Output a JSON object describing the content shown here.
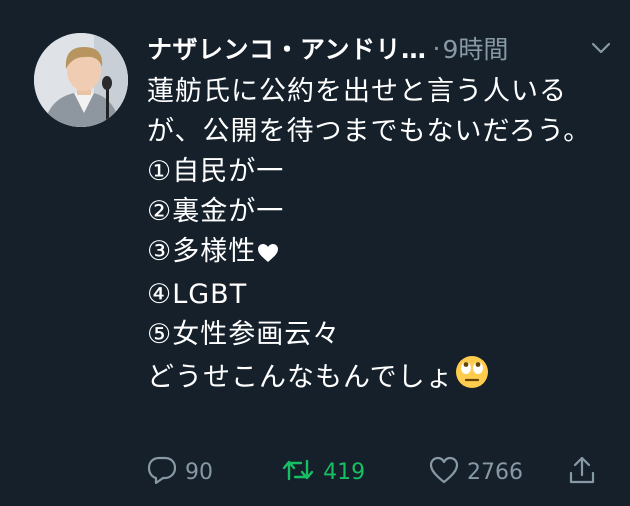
{
  "tweet": {
    "author_name": "ナザレンコ・アンドリ…",
    "separator": "·",
    "timestamp": "9時間",
    "body": {
      "intro": "蓮舫氏に公約を出せと言う人いるが、公開を待つまでもないだろう。",
      "items": [
        "①自民が一",
        "②裏金が一",
        "③多様性",
        "④LGBT",
        "⑤女性参画云々"
      ],
      "closing": "どうせこんなもんでしょ"
    },
    "inline_icons": [
      "white-heart-icon",
      "rolling-eyes-emoji-icon"
    ]
  },
  "actions": {
    "reply_count": "90",
    "retweet_count": "419",
    "like_count": "2766"
  },
  "colors": {
    "background": "#15202b",
    "text": "#ffffff",
    "muted": "#8899a6",
    "retweet_active": "#17bf63"
  }
}
